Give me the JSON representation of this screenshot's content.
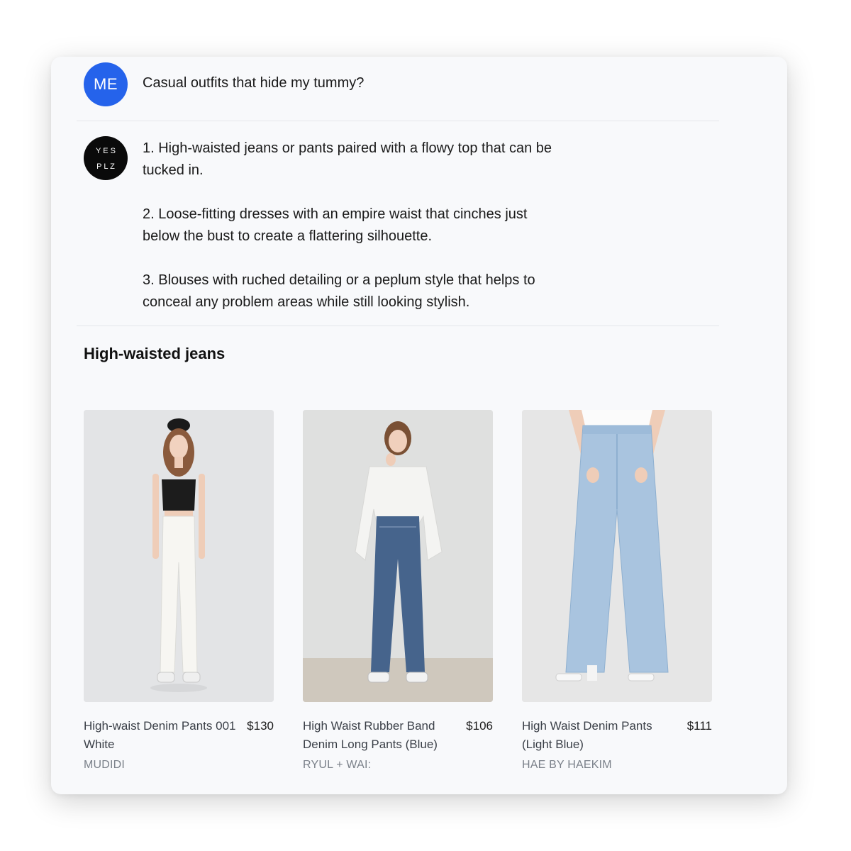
{
  "user_message": {
    "avatar_label": "ME",
    "text": "Casual outfits that hide my tummy?"
  },
  "bot_message": {
    "avatar_label_row1": "Y E S",
    "avatar_label_row2": "P L Z",
    "paragraphs": [
      "1. High-waisted jeans or pants paired with a flowy top that can be tucked in.",
      "2. Loose-fitting dresses with an empire waist that cinches just below the bust to create a flattering silhouette.",
      "3. Blouses with ruched detailing or a peplum style that helps to conceal any problem areas while still looking stylish."
    ]
  },
  "section": {
    "title": "High-waisted jeans"
  },
  "products": [
    {
      "name": "High-waist Denim Pants 001 White",
      "price": "$130",
      "brand": "MUDIDI"
    },
    {
      "name": "High Waist Rubber Band Denim Long Pants (Blue)",
      "price": "$106",
      "brand": "RYUL + WAI:"
    },
    {
      "name": "High Waist Denim Pants (Light Blue)",
      "price": "$111",
      "brand": "HAE BY HAEKIM"
    }
  ],
  "colors": {
    "accent": "#2563eb",
    "bot_avatar": "#0a0a0a",
    "card_bg": "#f8f9fb"
  }
}
